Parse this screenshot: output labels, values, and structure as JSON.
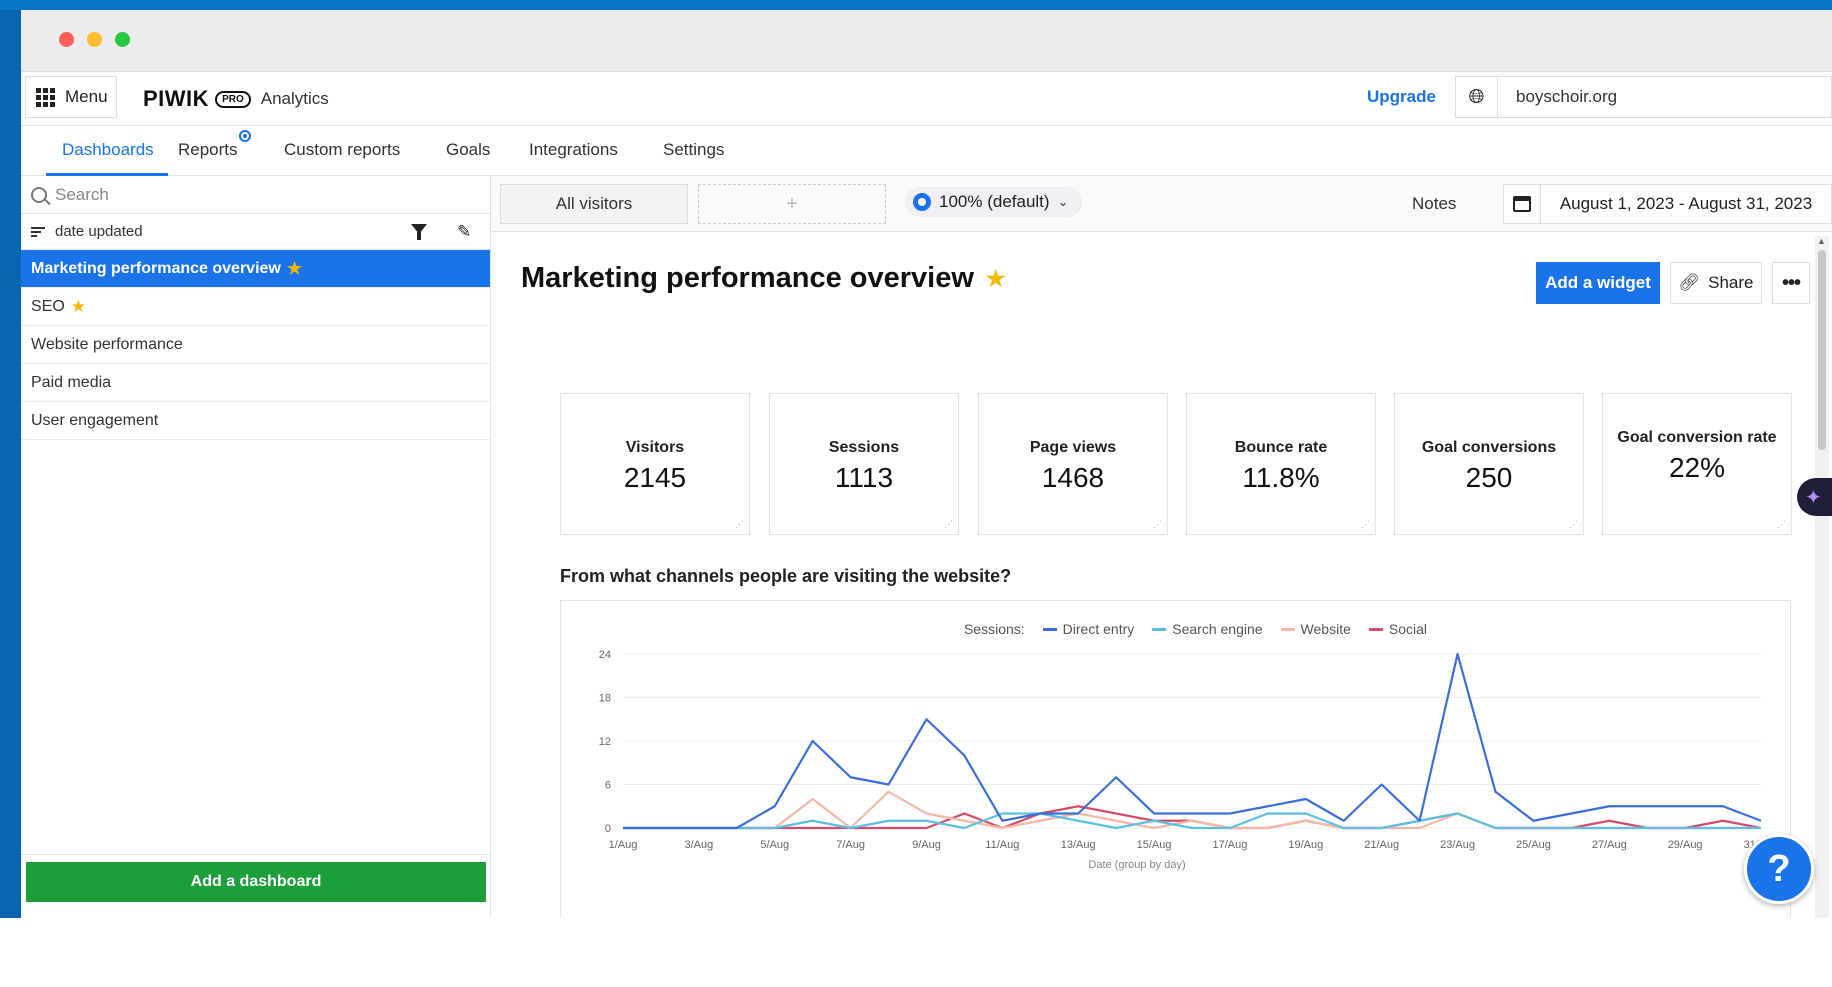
{
  "app": {
    "menu_label": "Menu",
    "logo_main": "PIWIK",
    "logo_pro": "PRO",
    "logo_sub": "Analytics",
    "upgrade_label": "Upgrade",
    "site": "boyschoir.org"
  },
  "tabs": [
    {
      "label": "Dashboards",
      "active": true
    },
    {
      "label": "Reports"
    },
    {
      "label": "Custom reports"
    },
    {
      "label": "Goals"
    },
    {
      "label": "Integrations"
    },
    {
      "label": "Settings"
    }
  ],
  "sidebar": {
    "search_placeholder": "Search",
    "sort_label": "date updated",
    "items": [
      {
        "label": "Marketing performance overview",
        "starred": true,
        "active": true
      },
      {
        "label": "SEO",
        "starred": true
      },
      {
        "label": "Website performance"
      },
      {
        "label": "Paid media"
      },
      {
        "label": "User engagement"
      }
    ],
    "add_dashboard_label": "Add a dashboard"
  },
  "toolbar": {
    "segment_label": "All visitors",
    "add_segment_label": "+",
    "sampling_label": "100% (default)",
    "notes_label": "Notes",
    "date_range": "August 1, 2023 - August 31, 2023"
  },
  "dashboard": {
    "title": "Marketing performance overview",
    "add_widget_label": "Add a widget",
    "share_label": "Share",
    "more_label": "•••"
  },
  "kpis": [
    {
      "label": "Visitors",
      "value": "2145"
    },
    {
      "label": "Sessions",
      "value": "1113"
    },
    {
      "label": "Page views",
      "value": "1468"
    },
    {
      "label": "Bounce rate",
      "value": "11.8%"
    },
    {
      "label": "Goal conversions",
      "value": "250"
    },
    {
      "label": "Goal conversion rate",
      "value": "22%"
    }
  ],
  "chart_section_title": "From what channels people are visiting the website?",
  "help_label": "?",
  "chart_data": {
    "type": "line",
    "legend_prefix": "Sessions:",
    "xlabel": "Date (group by day)",
    "ylabel": "",
    "ylim": [
      0,
      24
    ],
    "yticks": [
      0,
      6,
      12,
      18,
      24
    ],
    "x_tick_labels": [
      "1/Aug",
      "3/Aug",
      "5/Aug",
      "7/Aug",
      "9/Aug",
      "11/Aug",
      "13/Aug",
      "15/Aug",
      "17/Aug",
      "19/Aug",
      "21/Aug",
      "23/Aug",
      "25/Aug",
      "27/Aug",
      "29/Aug",
      "31/Aug"
    ],
    "x": [
      "1/Aug",
      "2/Aug",
      "3/Aug",
      "4/Aug",
      "5/Aug",
      "6/Aug",
      "7/Aug",
      "8/Aug",
      "9/Aug",
      "10/Aug",
      "11/Aug",
      "12/Aug",
      "13/Aug",
      "14/Aug",
      "15/Aug",
      "16/Aug",
      "17/Aug",
      "18/Aug",
      "19/Aug",
      "20/Aug",
      "21/Aug",
      "22/Aug",
      "23/Aug",
      "24/Aug",
      "25/Aug",
      "26/Aug",
      "27/Aug",
      "28/Aug",
      "29/Aug",
      "30/Aug",
      "31/Aug"
    ],
    "grid": true,
    "legend_position": "top",
    "series": [
      {
        "name": "Direct entry",
        "color": "#3a6fd8",
        "values": [
          0,
          0,
          0,
          0,
          3,
          12,
          7,
          6,
          15,
          10,
          1,
          2,
          2,
          7,
          2,
          2,
          2,
          3,
          4,
          1,
          6,
          1,
          24,
          5,
          1,
          2,
          3,
          3,
          3,
          3,
          1
        ]
      },
      {
        "name": "Search engine",
        "color": "#5bc0de",
        "values": [
          0,
          0,
          0,
          0,
          0,
          1,
          0,
          1,
          1,
          0,
          2,
          2,
          1,
          0,
          1,
          0,
          0,
          2,
          2,
          0,
          0,
          1,
          2,
          0,
          0,
          0,
          0,
          0,
          0,
          0,
          0
        ]
      },
      {
        "name": "Website",
        "color": "#f4b8a8",
        "values": [
          0,
          0,
          0,
          0,
          0,
          4,
          0,
          5,
          2,
          1,
          0,
          1,
          2,
          1,
          0,
          1,
          0,
          0,
          1,
          0,
          0,
          0,
          2,
          0,
          0,
          0,
          0,
          0,
          0,
          0,
          0
        ]
      },
      {
        "name": "Social",
        "color": "#d84a6a",
        "values": [
          0,
          0,
          0,
          0,
          0,
          0,
          0,
          0,
          0,
          2,
          0,
          2,
          3,
          2,
          1,
          1,
          0,
          0,
          1,
          0,
          0,
          1,
          2,
          0,
          0,
          0,
          1,
          0,
          0,
          1,
          0
        ]
      }
    ]
  }
}
